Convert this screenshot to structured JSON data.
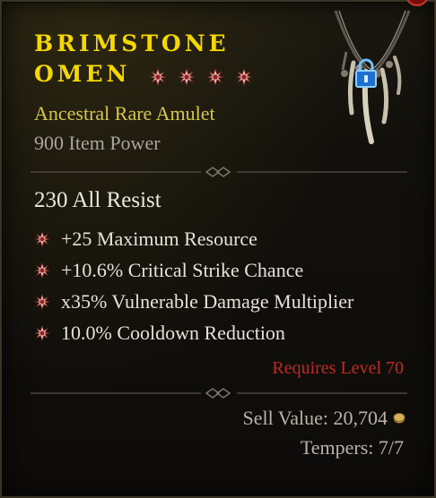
{
  "item": {
    "name_line1": "BRIMSTONE",
    "name_line2": "OMEN",
    "greater_affix_count": 4,
    "type": "Ancestral Rare Amulet",
    "item_power": "900 Item Power",
    "implicit": "230 All Resist",
    "affixes": [
      "+25 Maximum Resource",
      "+10.6% Critical Strike Chance",
      "x35% Vulnerable Damage Multiplier",
      "10.0% Cooldown Reduction"
    ],
    "requirement": "Requires Level 70",
    "sell_value": "Sell Value: 20,704",
    "tempers": "Tempers: 7/7"
  },
  "icons": {
    "greater_affix": "greater-affix-star-icon",
    "lock": "lock-icon",
    "gold": "gold-coin-icon",
    "item": "amulet-icon"
  },
  "colors": {
    "title": "#f4d800",
    "rarity": "#d6c74a",
    "requirement": "#c12a22",
    "greater_affix": "#f0b8b4",
    "lock": "#4aa8ff"
  }
}
